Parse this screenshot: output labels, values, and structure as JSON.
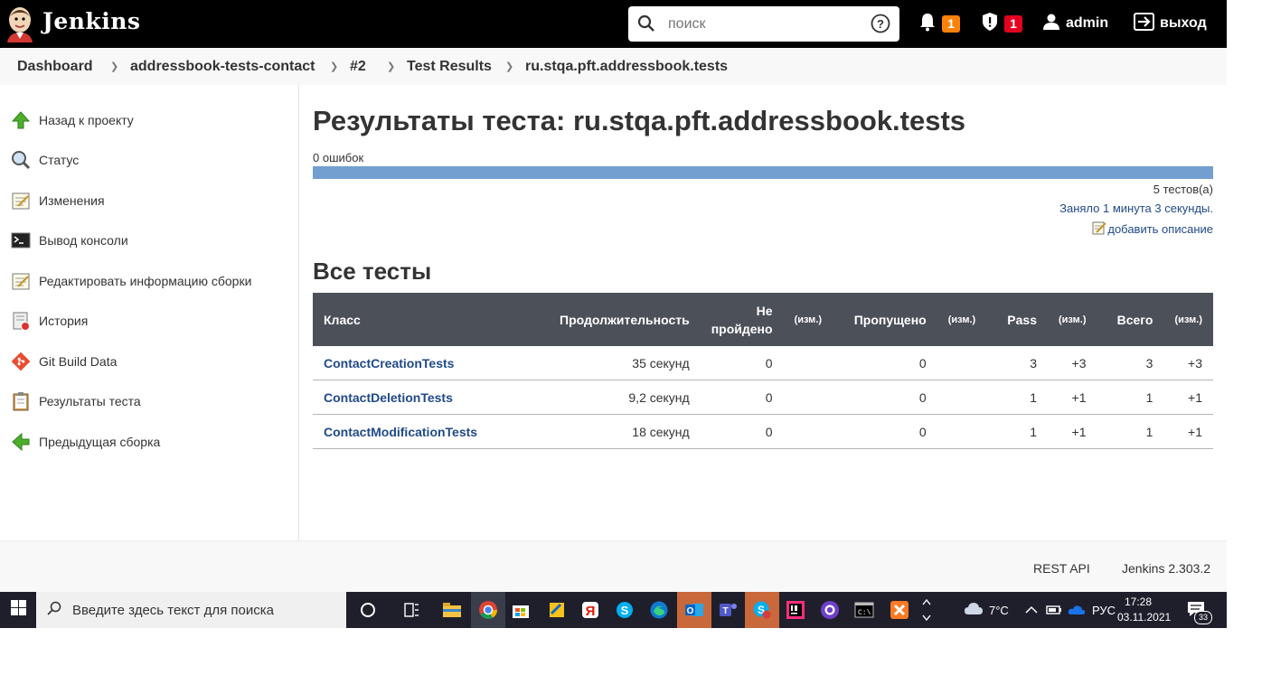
{
  "header": {
    "logo_text": "Jenkins",
    "search_placeholder": "поиск",
    "notifications_count": "1",
    "security_count": "1",
    "user": "admin",
    "logout": "выход"
  },
  "breadcrumbs": [
    "Dashboard",
    "addressbook-tests-contact",
    "#2",
    "Test Results",
    "ru.stqa.pft.addressbook.tests"
  ],
  "sidebar": {
    "items": [
      {
        "label": "Назад к проекту",
        "icon": "up-arrow-icon"
      },
      {
        "label": "Статус",
        "icon": "magnifier-icon"
      },
      {
        "label": "Изменения",
        "icon": "notepad-icon"
      },
      {
        "label": "Вывод консоли",
        "icon": "terminal-icon"
      },
      {
        "label": "Редактировать информацию сборки",
        "icon": "notepad-icon"
      },
      {
        "label": "История",
        "icon": "history-icon"
      },
      {
        "label": "Git Build Data",
        "icon": "git-icon"
      },
      {
        "label": "Результаты теста",
        "icon": "clipboard-icon"
      },
      {
        "label": "Предыдущая сборка",
        "icon": "left-arrow-icon"
      }
    ]
  },
  "main": {
    "title": "Результаты теста: ru.stqa.pft.addressbook.tests",
    "failures": "0 ошибок",
    "total_tests": "5 тестов(а)",
    "took": "Заняло 1 минута 3 секунды.",
    "add_description": "добавить описание",
    "all_tests_heading": "Все тесты",
    "columns": [
      "Класс",
      "Продолжительность",
      "Не пройдено",
      "(изм.)",
      "Пропущено",
      "(изм.)",
      "Pass",
      "(изм.)",
      "Всего",
      "(изм.)"
    ],
    "rows": [
      {
        "class": "ContactCreationTests",
        "duration": "35 секунд",
        "fail": "0",
        "fail_diff": "",
        "skip": "0",
        "skip_diff": "",
        "pass": "3",
        "pass_diff": "+3",
        "total": "3",
        "total_diff": "+3"
      },
      {
        "class": "ContactDeletionTests",
        "duration": "9,2 секунд",
        "fail": "0",
        "fail_diff": "",
        "skip": "0",
        "skip_diff": "",
        "pass": "1",
        "pass_diff": "+1",
        "total": "1",
        "total_diff": "+1"
      },
      {
        "class": "ContactModificationTests",
        "duration": "18 секунд",
        "fail": "0",
        "fail_diff": "",
        "skip": "0",
        "skip_diff": "",
        "pass": "1",
        "pass_diff": "+1",
        "total": "1",
        "total_diff": "+1"
      }
    ]
  },
  "footer": {
    "rest_api": "REST API",
    "version": "Jenkins 2.303.2"
  },
  "taskbar": {
    "search_text": "Введите здесь текст для поиска",
    "weather": "7°C",
    "lang": "РУС",
    "time": "17:28",
    "date": "03.11.2021",
    "notif_count": "33"
  },
  "colors": {
    "header_bg": "#000000",
    "progress_bar": "#729fcf",
    "table_header": "#4c5058",
    "link": "#204a87",
    "badge_orange": "#fe820a",
    "badge_red": "#e6001f"
  }
}
